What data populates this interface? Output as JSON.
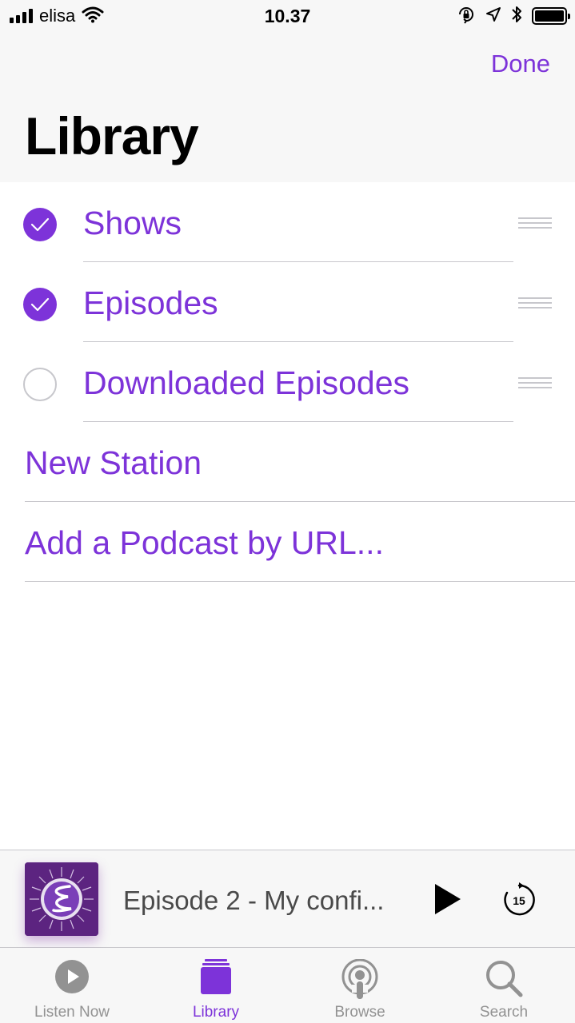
{
  "status_bar": {
    "carrier": "elisa",
    "time": "10.37",
    "icons": [
      "signal-icon",
      "wifi-icon",
      "orientation-lock-icon",
      "location-icon",
      "bluetooth-icon",
      "battery-icon"
    ]
  },
  "header": {
    "done_label": "Done",
    "title": "Library"
  },
  "library_items": [
    {
      "label": "Shows",
      "checked": true
    },
    {
      "label": "Episodes",
      "checked": true
    },
    {
      "label": "Downloaded Episodes",
      "checked": false
    }
  ],
  "actions": {
    "new_station": "New Station",
    "add_podcast_url": "Add a Podcast by URL..."
  },
  "mini_player": {
    "episode_title": "Episode 2 - My confi...",
    "play_icon": "play-icon",
    "skip_icon": "skip-back-15-icon",
    "skip_seconds": "15"
  },
  "tab_bar": {
    "tabs": [
      {
        "label": "Listen Now",
        "icon": "play-circle-icon",
        "active": false
      },
      {
        "label": "Library",
        "icon": "library-stack-icon",
        "active": true
      },
      {
        "label": "Browse",
        "icon": "podcast-icon",
        "active": false
      },
      {
        "label": "Search",
        "icon": "search-icon",
        "active": false
      }
    ]
  },
  "colors": {
    "accent": "#7d33d9",
    "inactive": "#929292",
    "separator": "#c8c7cc",
    "bar_background": "#f7f7f7"
  }
}
